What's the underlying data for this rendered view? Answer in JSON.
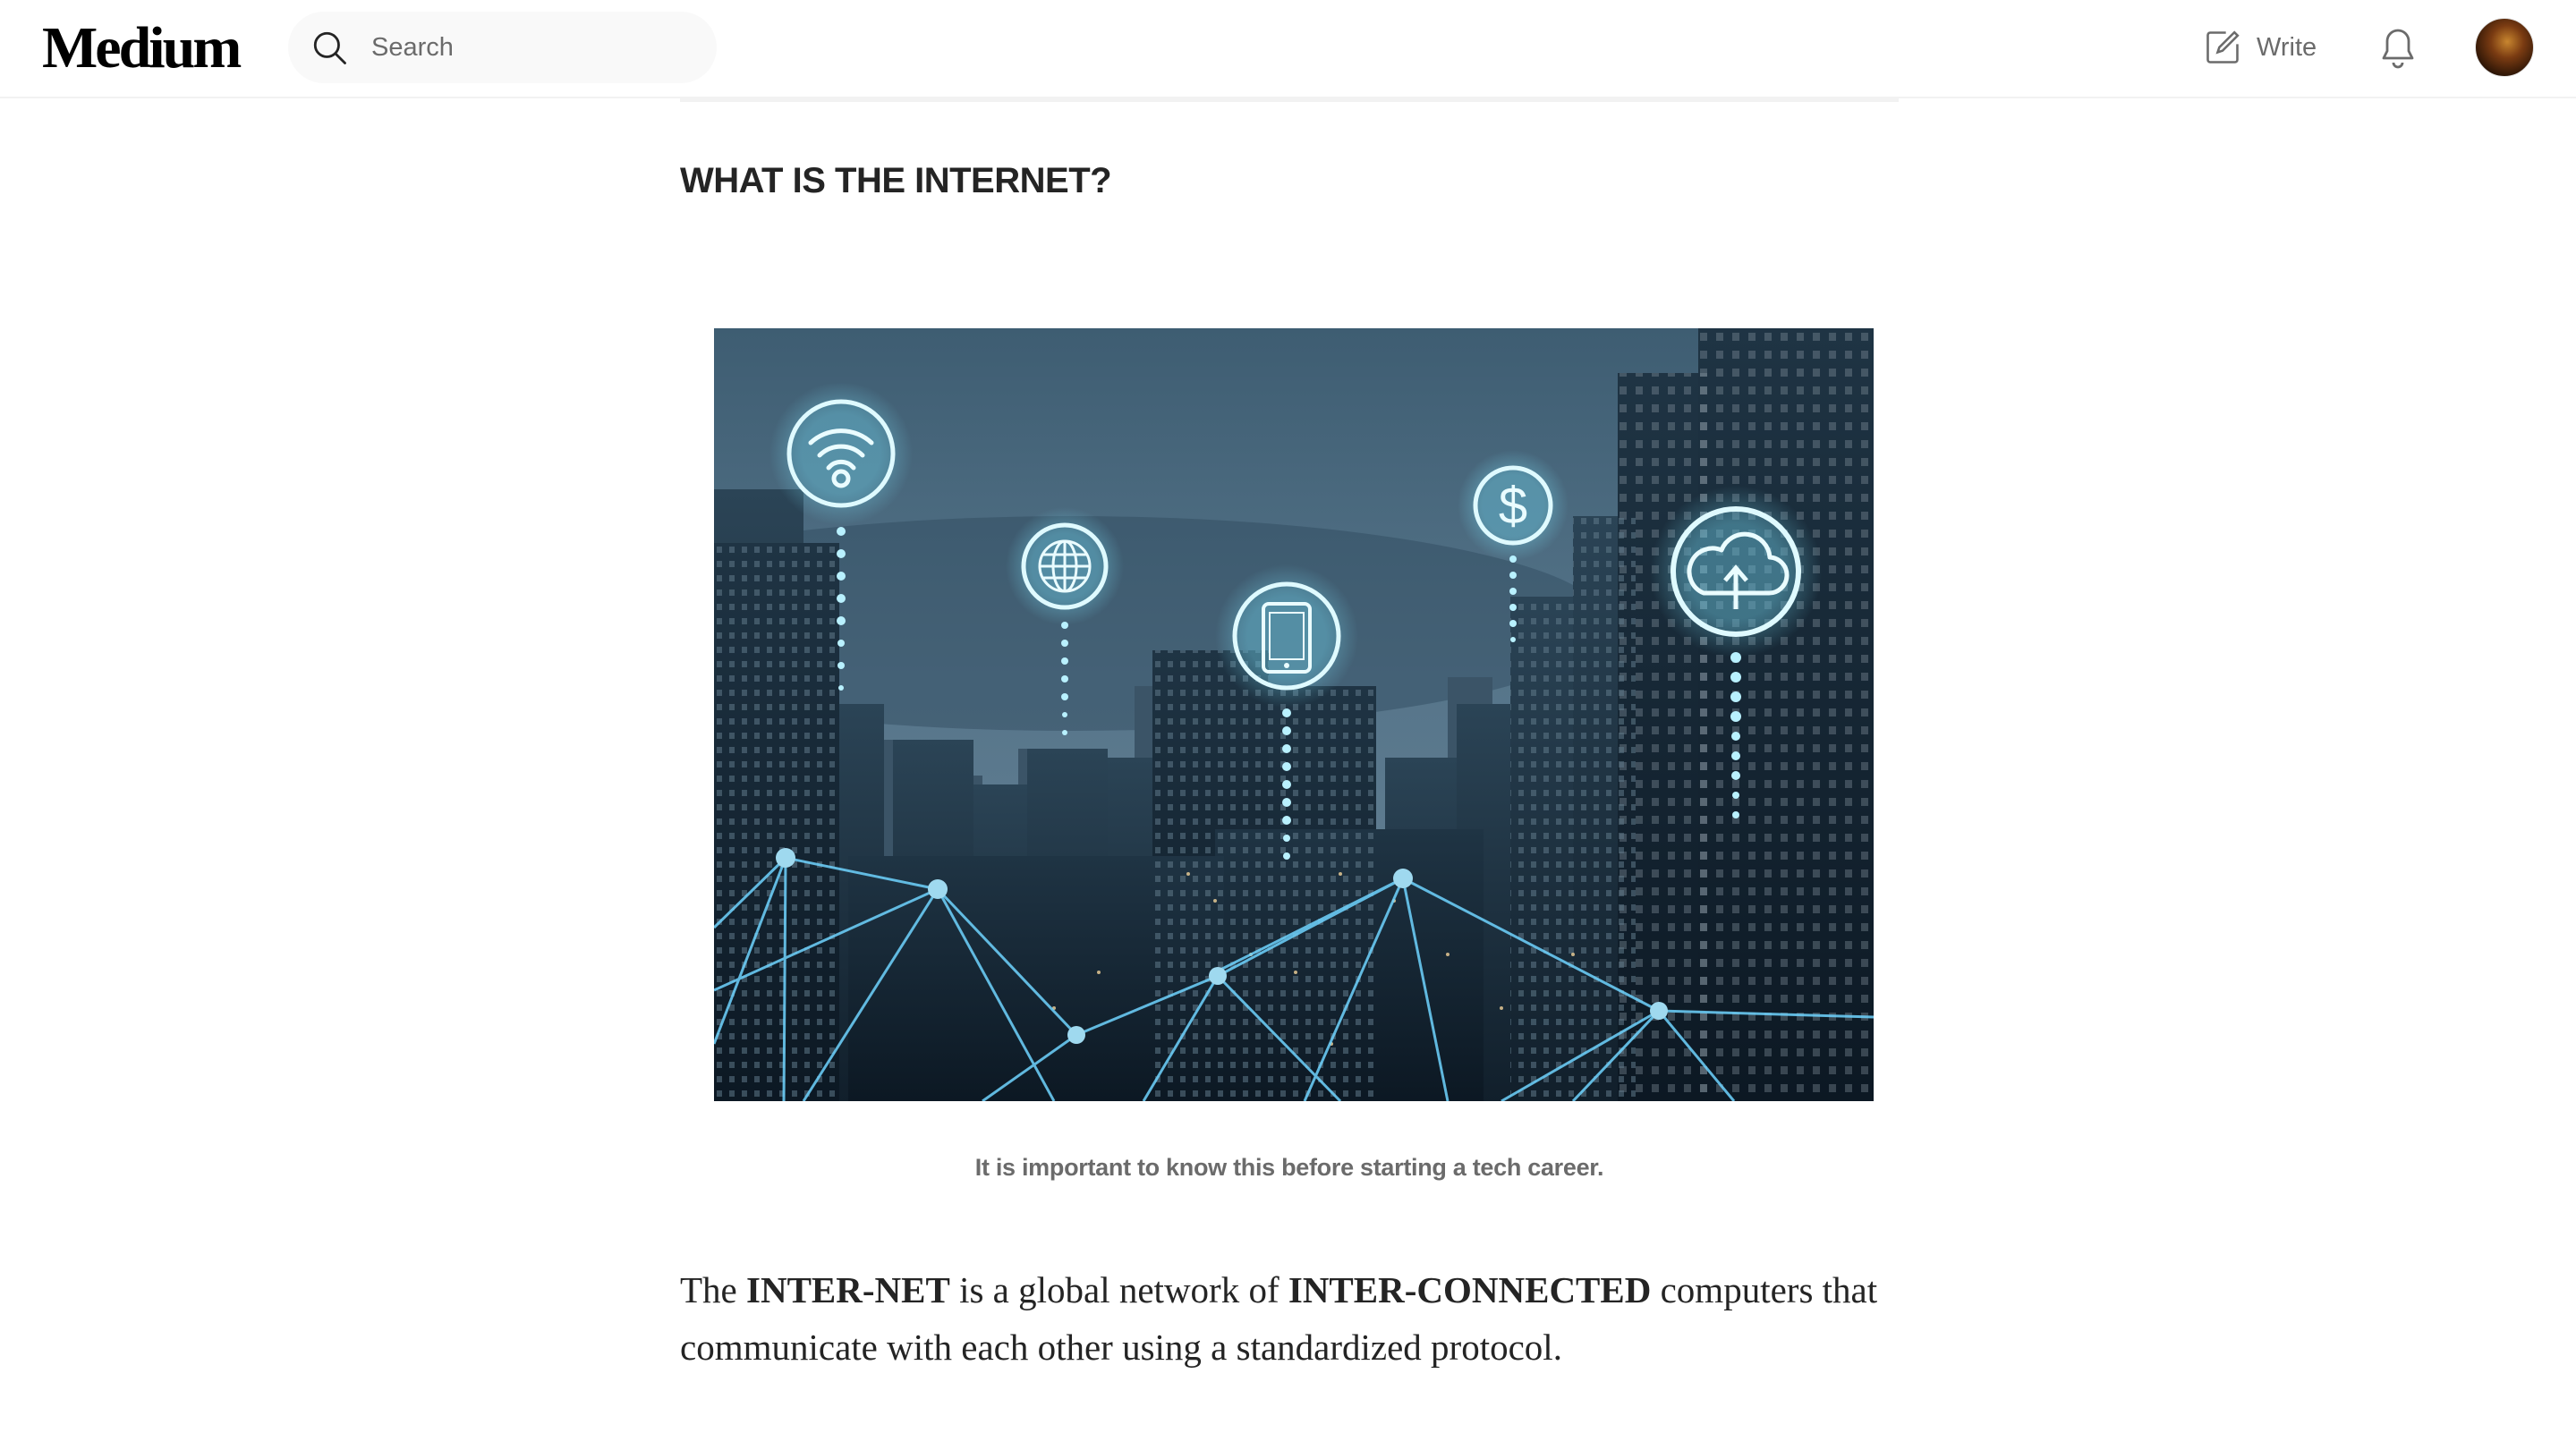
{
  "header": {
    "logo": "Medium",
    "search_placeholder": "Search",
    "write_label": "Write",
    "icons": {
      "search": "search-icon",
      "write": "pencil-square-icon",
      "notifications": "bell-icon",
      "avatar": "user-avatar"
    }
  },
  "article": {
    "heading": "WHAT IS THE INTERNET?",
    "figure": {
      "description_icons": [
        "wifi-icon",
        "globe-icon",
        "smartphone-icon",
        "dollar-icon",
        "cloud-upload-icon"
      ],
      "caption": "It is important to know this before starting a tech career."
    },
    "paragraph": {
      "p1": "The ",
      "b1": "INTER-NET",
      "p2": " is a global network of ",
      "b2": "INTER-CONNECTED",
      "p3": " computers that communicate with each other using a standardized protocol."
    }
  },
  "colors": {
    "text": "#242424",
    "muted": "#6b6b6b",
    "search_bg": "#f9f9f9",
    "glow": "#7fe7ff"
  }
}
